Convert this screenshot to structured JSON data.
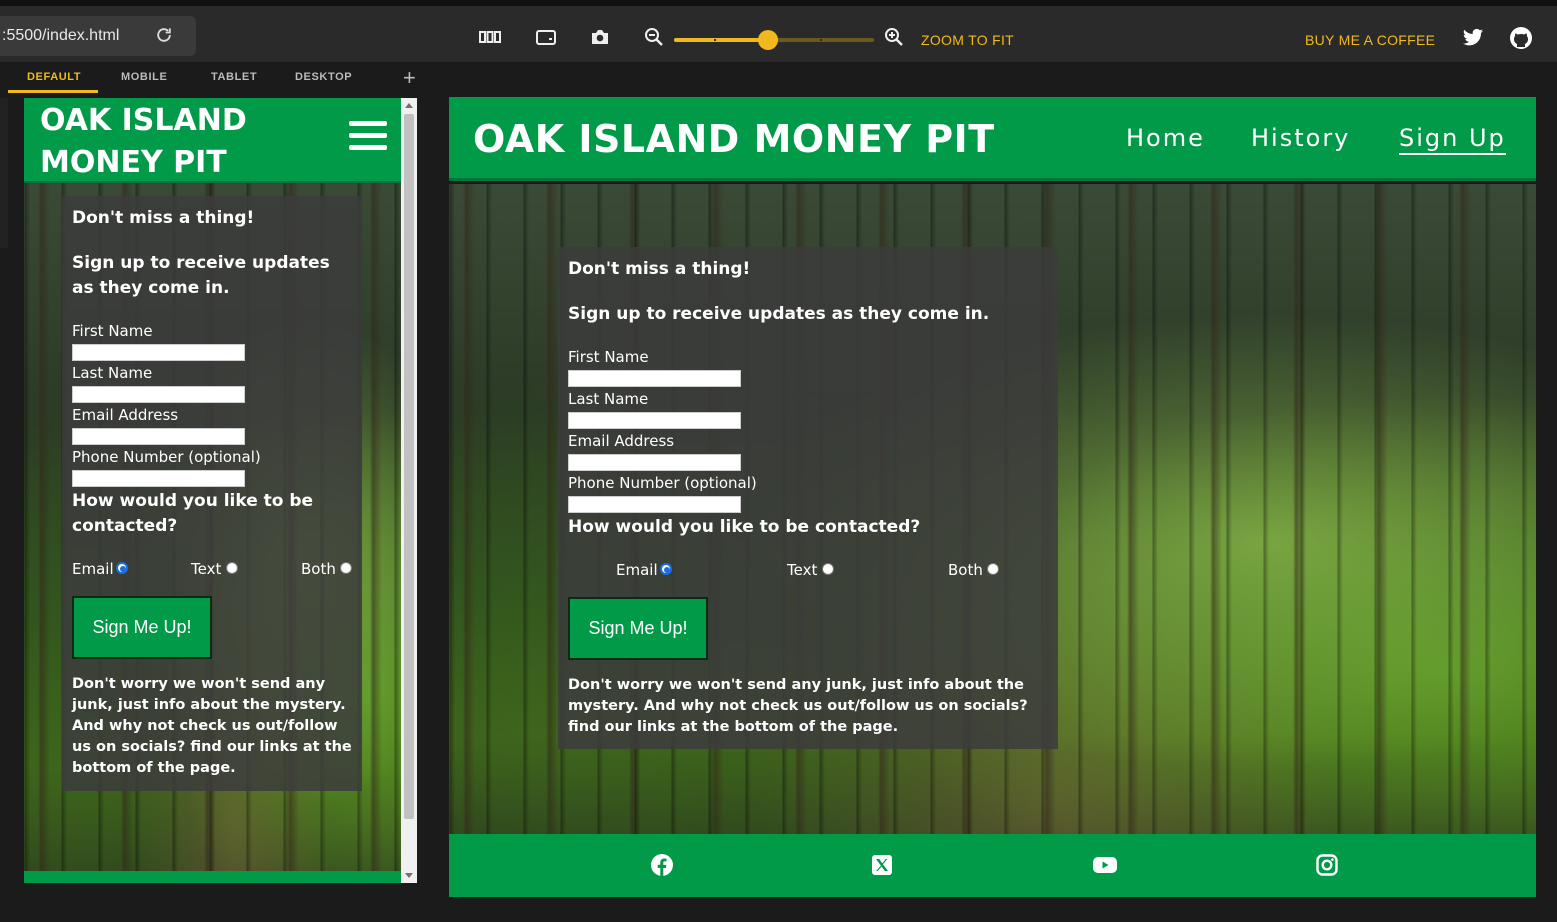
{
  "toolbar": {
    "url": ":5500/index.html",
    "zoom_to_fit": "ZOOM TO FIT",
    "buy_coffee": "BUY ME A COFFEE",
    "zoom_level": 0.47,
    "accent_color": "#f0b91d"
  },
  "tabs": [
    {
      "label": "DEFAULT",
      "active": true
    },
    {
      "label": "MOBILE"
    },
    {
      "label": "TABLET"
    },
    {
      "label": "DESKTOP"
    }
  ],
  "site": {
    "title": "OAK ISLAND MONEY PIT",
    "brand_color": "#009a49",
    "nav": [
      {
        "label": "Home"
      },
      {
        "label": "History"
      },
      {
        "label": "Sign Up",
        "active": true
      }
    ],
    "form": {
      "intro": "Don't miss a thing!",
      "subtitle": "Sign up to receive updates as they come in.",
      "fields": [
        "First Name",
        "Last Name",
        "Email Address",
        "Phone Number (optional)"
      ],
      "contact_question": "How would you like to be contacted?",
      "contact_options": [
        {
          "label": "Email",
          "checked": true
        },
        {
          "label": "Text"
        },
        {
          "label": "Both"
        }
      ],
      "submit": "Sign Me Up!",
      "note": "Don't worry we won't send any junk, just info about the mystery. And why not check us out/follow us on socials? find our links at the bottom of the page."
    },
    "footer_icons": [
      "facebook-icon",
      "x-twitter-icon",
      "youtube-icon",
      "instagram-icon"
    ]
  }
}
